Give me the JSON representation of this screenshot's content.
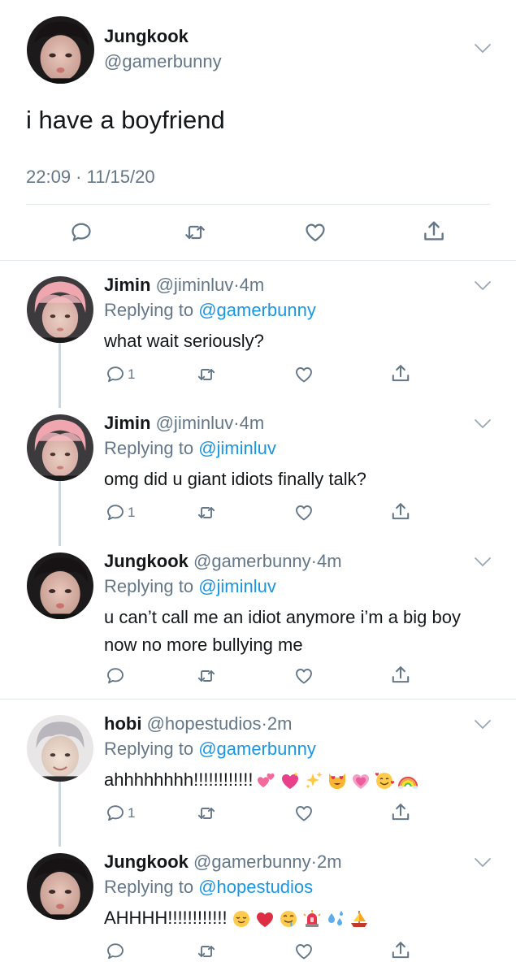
{
  "tweet": {
    "name": "Jungkook",
    "handle": "@gamerbunny",
    "text": "i have a boyfriend",
    "meta": "22:09 · 11/15/20"
  },
  "replies": [
    {
      "name": "Jimin",
      "handle": "@jiminluv",
      "dot": "·",
      "time": "4m",
      "replying_prefix": "Replying to ",
      "mention": "@gamerbunny",
      "text": "what wait seriously?",
      "reply_count": "1"
    },
    {
      "name": "Jimin",
      "handle": "@jiminluv",
      "dot": "·",
      "time": "4m",
      "replying_prefix": "Replying to ",
      "mention": "@jiminluv",
      "text": "omg did u giant idiots finally talk?",
      "reply_count": "1"
    },
    {
      "name": "Jungkook",
      "handle": "@gamerbunny",
      "dot": "·",
      "time": "4m",
      "replying_prefix": "Replying to ",
      "mention": "@jiminluv",
      "text": "u can’t call me an idiot anymore i’m a big boy now no more bullying me",
      "reply_count": ""
    },
    {
      "name": "hobi",
      "handle": "@hopestudios",
      "dot": "·",
      "time": "2m",
      "replying_prefix": "Replying to ",
      "mention": "@gamerbunny",
      "text": "ahhhhhhhh!!!!!!!!!!!!",
      "emojis": [
        "two-hearts-emoji",
        "sparkling-heart-emoji",
        "sparkles-emoji",
        "heart-eyes-cat-emoji",
        "growing-heart-emoji",
        "smiling-face-with-hearts-emoji",
        "rainbow-emoji"
      ],
      "reply_count": "1"
    },
    {
      "name": "Jungkook",
      "handle": "@gamerbunny",
      "dot": "·",
      "time": "2m",
      "replying_prefix": "Replying to ",
      "mention": "@hopestudios",
      "text": "AHHHH!!!!!!!!!!!!",
      "emojis": [
        "relieved-face-emoji",
        "red-heart-emoji",
        "drooling-face-emoji",
        "siren-emoji",
        "sweat-droplets-emoji",
        "sailboat-emoji"
      ],
      "reply_count": ""
    }
  ],
  "icons": [
    "reply-icon",
    "retweet-icon",
    "like-icon",
    "share-icon",
    "chevron-down-icon"
  ],
  "colors": {
    "link": "#1b95e0",
    "secondary": "#657786",
    "primary": "#14171a",
    "divider": "#e1e8ed",
    "thread_line": "#ccd6dd",
    "icon": "#657786"
  }
}
